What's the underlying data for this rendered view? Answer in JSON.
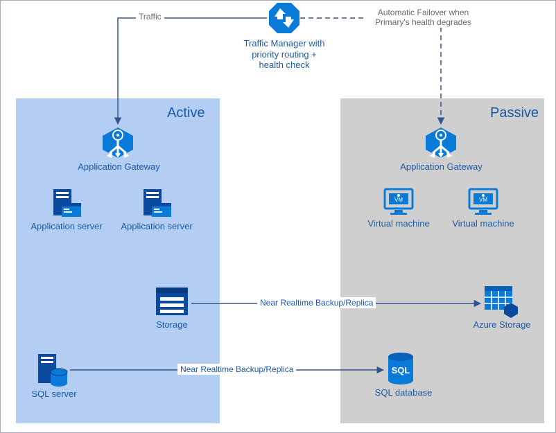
{
  "traffic_label": "Traffic",
  "failover_label": "Automatic Failover when Primary's health degrades",
  "traffic_manager": "Traffic Manager with priority routing + health check",
  "active_title": "Active",
  "passive_title": "Passive",
  "app_gateway": "Application Gateway",
  "app_server": "Application server",
  "storage": "Storage",
  "sql_server": "SQL server",
  "virtual_machine": "Virtual machine",
  "azure_storage": "Azure Storage",
  "sql_database": "SQL database",
  "backup_label": "Near Realtime Backup/Replica",
  "chart_data": {
    "type": "diagram",
    "title": "Active/Passive failover architecture with Traffic Manager",
    "nodes": [
      {
        "id": "tm",
        "name": "Traffic Manager with priority routing + health check",
        "region": "global"
      },
      {
        "id": "agA",
        "name": "Application Gateway",
        "region": "Active"
      },
      {
        "id": "as1",
        "name": "Application server",
        "region": "Active"
      },
      {
        "id": "as2",
        "name": "Application server",
        "region": "Active"
      },
      {
        "id": "stA",
        "name": "Storage",
        "region": "Active"
      },
      {
        "id": "sqlA",
        "name": "SQL server",
        "region": "Active"
      },
      {
        "id": "agP",
        "name": "Application Gateway",
        "region": "Passive"
      },
      {
        "id": "vm1",
        "name": "Virtual machine",
        "region": "Passive"
      },
      {
        "id": "vm2",
        "name": "Virtual machine",
        "region": "Passive"
      },
      {
        "id": "stP",
        "name": "Azure Storage",
        "region": "Passive"
      },
      {
        "id": "sqlP",
        "name": "SQL database",
        "region": "Passive"
      }
    ],
    "edges": [
      {
        "from": "tm",
        "to": "agA",
        "label": "Traffic",
        "style": "solid"
      },
      {
        "from": "tm",
        "to": "agP",
        "label": "Automatic Failover when Primary's health degrades",
        "style": "dashed"
      },
      {
        "from": "stA",
        "to": "stP",
        "label": "Near Realtime Backup/Replica",
        "style": "solid"
      },
      {
        "from": "sqlA",
        "to": "sqlP",
        "label": "Near Realtime Backup/Replica",
        "style": "solid"
      }
    ]
  }
}
